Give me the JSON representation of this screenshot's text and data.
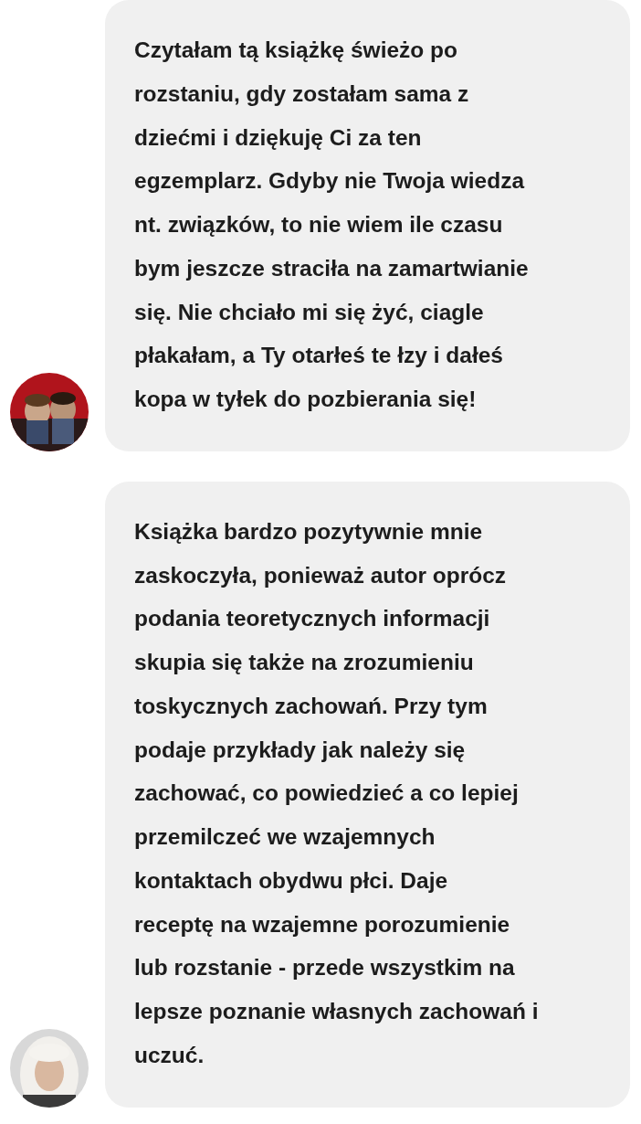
{
  "messages": [
    {
      "lines": [
        "Czytałam tą książkę świeżo po",
        "rozstaniu, gdy zostałam sama z",
        "dziećmi i dziękuję Ci za ten",
        "egzemplarz. Gdyby nie Twoja wiedza",
        "nt. związków, to nie wiem ile czasu",
        "bym jeszcze straciła na zamartwianie",
        "się. Nie chciało mi się żyć, ciagle",
        "płakałam, a Ty otarłeś te łzy i dałeś",
        "kopa w tyłek do pozbierania się!"
      ]
    },
    {
      "lines": [
        "Książka bardzo pozytywnie mnie",
        "zaskoczyła, ponieważ autor oprócz",
        "podania teoretycznych informacji",
        "skupia się także na zrozumieniu",
        "toskycznych zachowań. Przy tym",
        "podaje przykłady jak należy się",
        "zachować, co powiedzieć a co lepiej",
        "przemilczeć we wzajemnych",
        "kontaktach obydwu płci. Daje",
        "receptę na wzajemne porozumienie",
        "lub rozstanie - przede wszystkim na",
        "lepsze poznanie własnych zachowań i",
        "uczuć."
      ]
    }
  ]
}
